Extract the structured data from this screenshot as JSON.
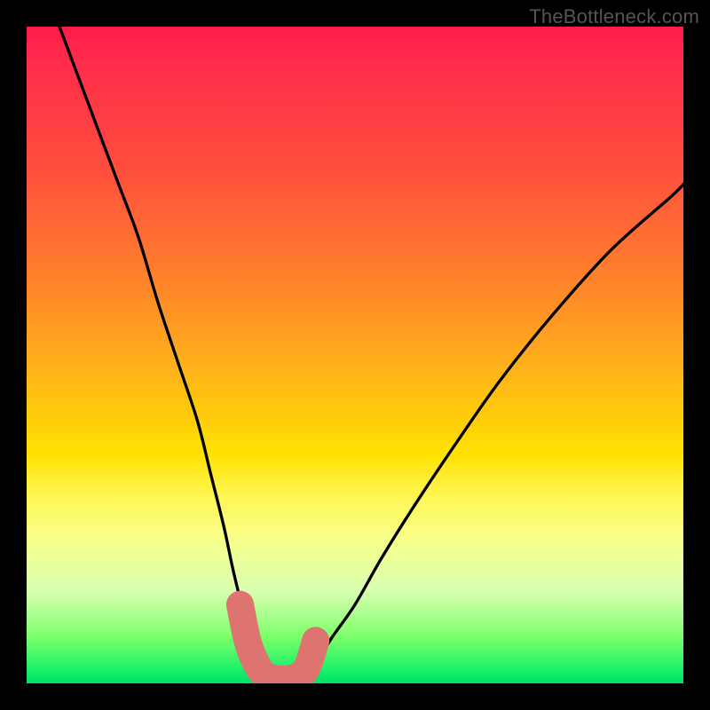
{
  "watermark": "TheBottleneck.com",
  "chart_data": {
    "type": "line",
    "title": "",
    "xlabel": "",
    "ylabel": "",
    "xlim": [
      0,
      100
    ],
    "ylim": [
      0,
      100
    ],
    "grid": false,
    "legend": false,
    "background_gradient_stops": [
      {
        "pos": 0.0,
        "color": "#ff1a4a"
      },
      {
        "pos": 0.2,
        "color": "#ff4a3e"
      },
      {
        "pos": 0.36,
        "color": "#ff7a2e"
      },
      {
        "pos": 0.52,
        "color": "#ffb11a"
      },
      {
        "pos": 0.65,
        "color": "#ffe100"
      },
      {
        "pos": 0.78,
        "color": "#f8ff8a"
      },
      {
        "pos": 0.93,
        "color": "#7bff6a"
      },
      {
        "pos": 1.0,
        "color": "#00e068"
      }
    ],
    "series": [
      {
        "name": "left-branch",
        "stroke": "#000000",
        "x": [
          5,
          8,
          11,
          14,
          17,
          20,
          23,
          26,
          28,
          30,
          31.5,
          33,
          34.5,
          36,
          37.5
        ],
        "y": [
          100,
          92,
          84,
          76,
          68,
          58,
          49,
          40,
          32,
          24,
          17,
          11,
          6,
          3,
          1
        ]
      },
      {
        "name": "right-branch",
        "stroke": "#000000",
        "x": [
          42,
          44,
          46.5,
          50,
          54,
          59,
          65,
          72,
          80,
          89,
          98,
          100
        ],
        "y": [
          1,
          3,
          7,
          12,
          19,
          27,
          36,
          46,
          56,
          66,
          74,
          76
        ]
      },
      {
        "name": "valley-fit-band",
        "stroke": "#dd7470",
        "stroke_width": 4.2,
        "x": [
          32.5,
          33.5,
          34.5,
          36,
          38,
          40,
          42,
          43,
          44
        ],
        "y": [
          12,
          7,
          4,
          1.5,
          0.7,
          0.7,
          1.5,
          3.2,
          6.5
        ]
      }
    ],
    "markers": [
      {
        "name": "fit-dot",
        "x": 32.8,
        "y": 11.0,
        "r": 1.1,
        "color": "#dd7470"
      },
      {
        "name": "fit-dot",
        "x": 33.6,
        "y": 7.0,
        "r": 1.1,
        "color": "#dd7470"
      },
      {
        "name": "fit-dot",
        "x": 34.6,
        "y": 3.8,
        "r": 1.1,
        "color": "#dd7470"
      },
      {
        "name": "fit-dot",
        "x": 36.2,
        "y": 1.4,
        "r": 1.1,
        "color": "#dd7470"
      },
      {
        "name": "fit-dot",
        "x": 41.4,
        "y": 1.2,
        "r": 1.1,
        "color": "#dd7470"
      },
      {
        "name": "fit-dot",
        "x": 43.6,
        "y": 5.0,
        "r": 1.1,
        "color": "#dd7470"
      }
    ]
  }
}
